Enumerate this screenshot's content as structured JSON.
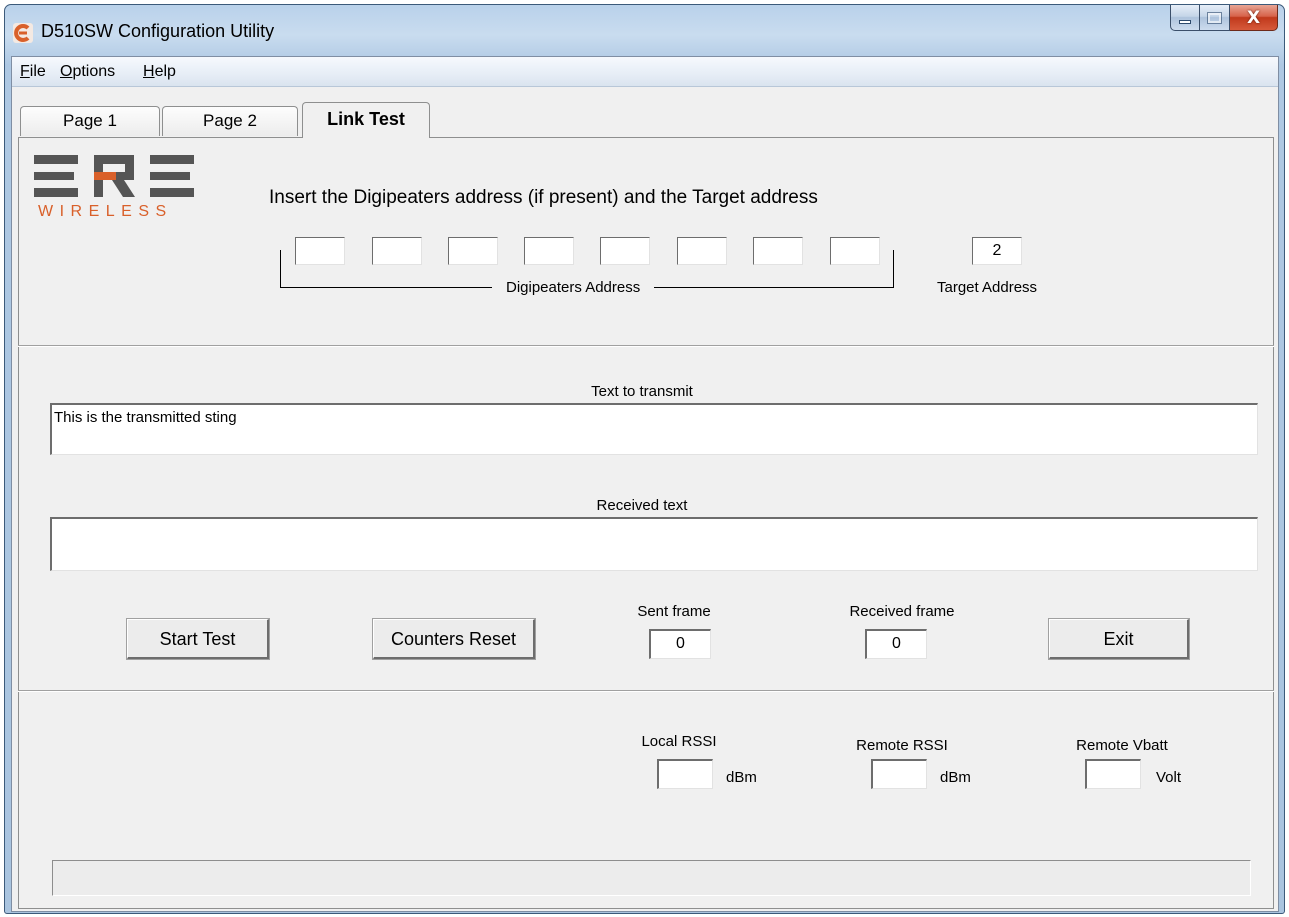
{
  "window": {
    "title": "D510SW  Configuration Utility",
    "controls": {
      "minimize": "",
      "maximize": "",
      "close": "X"
    }
  },
  "menu": {
    "items": [
      {
        "label": "File",
        "underline": "F",
        "rest": "ile"
      },
      {
        "label": "Options",
        "underline": "O",
        "rest": "ptions"
      },
      {
        "label": "Help",
        "underline": "H",
        "rest": "elp"
      }
    ]
  },
  "tabs": [
    {
      "label": "Page 1",
      "active": false
    },
    {
      "label": "Page 2",
      "active": false
    },
    {
      "label": "Link Test",
      "active": true
    }
  ],
  "logo": {
    "main": "ERE",
    "sub": "WIRELESS",
    "main_color": "#555555",
    "accent_color": "#d9602a"
  },
  "address": {
    "instruction": "Insert the Digipeaters address (if present) and the Target address",
    "digipeaters": [
      "",
      "",
      "",
      "",
      "",
      "",
      "",
      ""
    ],
    "digipeaters_label": "Digipeaters Address",
    "target_value": "2",
    "target_label": "Target Address"
  },
  "transmit": {
    "label": "Text to transmit",
    "value": "This is the transmitted sting"
  },
  "received": {
    "label": "Received text",
    "value": ""
  },
  "controls": {
    "start_test": "Start Test",
    "counters_reset": "Counters Reset",
    "exit": "Exit",
    "sent_frame_label": "Sent frame",
    "sent_frame_value": "0",
    "received_frame_label": "Received frame",
    "received_frame_value": "0"
  },
  "rssi": {
    "local_label": "Local  RSSI",
    "local_value": "",
    "local_unit": "dBm",
    "remote_label": "Remote RSSI",
    "remote_value": "",
    "remote_unit": "dBm",
    "vbatt_label": "Remote Vbatt",
    "vbatt_value": "",
    "vbatt_unit": "Volt"
  },
  "status": {
    "text": ""
  }
}
